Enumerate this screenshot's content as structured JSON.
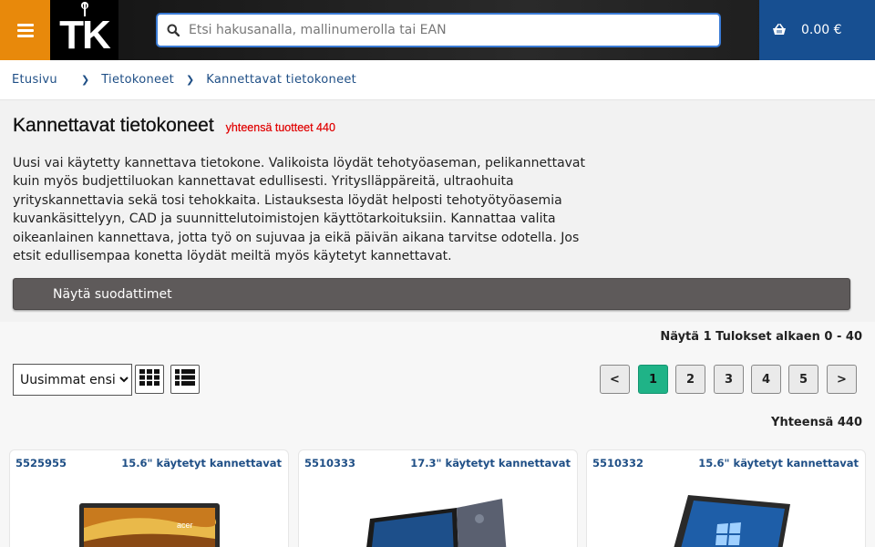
{
  "header": {
    "search_placeholder": "Etsi hakusanalla, mallinumerolla tai EAN",
    "cart_amount": "0.00 €",
    "logo_text": "TK"
  },
  "breadcrumb": [
    "Etusivu",
    "Tietokoneet",
    "Kannettavat tietokoneet"
  ],
  "category": {
    "title": "Kannettavat tietokoneet",
    "count_label": "yhteensä tuotteet 440",
    "description": "Uusi vai käytetty kannettava tietokone. Valikoista löydät tehotyöaseman, pelikannettavat kuin myös budjettiluokan kannettavat edullisesti. Yrityslläppäreitä, ultraohuita yrityskannettavia sekä tosi tehokkaita. Listauksesta löydät helposti tehotyötyöasemia kuvankäsittelyyn, CAD ja suunnittelutoimistojen käyttötarkoituksiin. Kannattaa valita oikeanlainen kannettava, jotta työ on sujuvaa ja eikä päivän aikana tarvitse odotella. Jos etsit edullisempaa konetta löydät meiltä myös käytetyt kannettavat.",
    "filter_button": "Näytä suodattimet"
  },
  "results": {
    "showing": "Näytä 1 Tulokset alkaen 0 - 40",
    "sort_selected": "Uusimmat ensin",
    "pager": [
      "<",
      "1",
      "2",
      "3",
      "4",
      "5",
      ">"
    ],
    "active_page": "1",
    "total": "Yhteensä 440"
  },
  "products": [
    {
      "sku": "5525955",
      "category": "15.6\" käytetyt kannettavat"
    },
    {
      "sku": "5510333",
      "category": "17.3\" käytetyt kannettavat"
    },
    {
      "sku": "5510332",
      "category": "15.6\" käytetyt kannettavat"
    }
  ],
  "colors": {
    "menu_orange": "#e8890b",
    "cart_blue": "#174f91",
    "count_red": "#e00000",
    "active_page_green": "#1fb387",
    "link_blue": "#1f4f86"
  },
  "icons": {
    "menu": "hamburger-icon",
    "search": "search-icon",
    "cart": "basket-icon",
    "grid": "grid-view-icon",
    "list": "list-view-icon",
    "breadcrumb_separator": "chevron-right-icon"
  }
}
